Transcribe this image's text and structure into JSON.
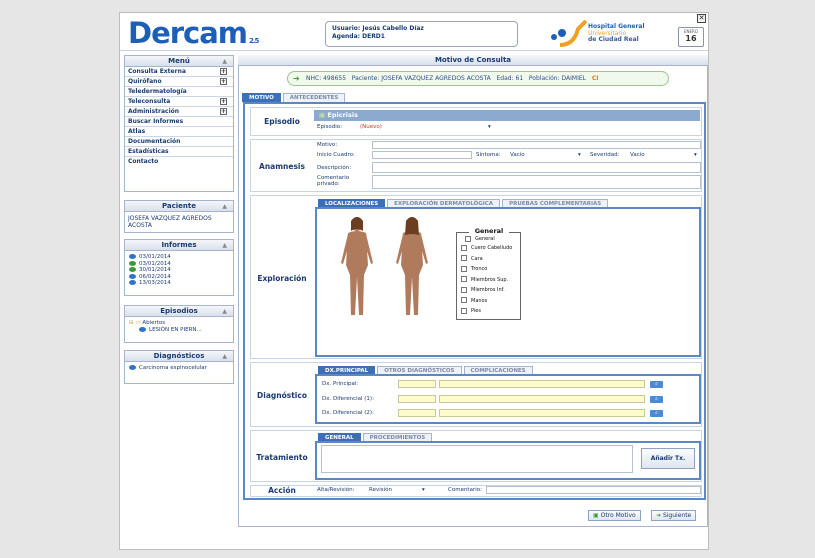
{
  "app": {
    "name": "Dercam",
    "version": "2.5"
  },
  "header": {
    "user_label": "Usuario: Jesús Cabello Díaz",
    "agenda_label": "Agenda: DERD1",
    "hospital_lines": [
      "Hospital General",
      "Universitario",
      "de Ciudad Real"
    ],
    "date_month": "ENERO",
    "date_day": "16",
    "close": "✕"
  },
  "menu": {
    "title": "Menú",
    "items": [
      {
        "label": "Consulta Externa",
        "expand": "+"
      },
      {
        "label": "Quirófano",
        "expand": "+"
      },
      {
        "label": "Teledermatología"
      },
      {
        "label": "Teleconsulta",
        "expand": "+"
      },
      {
        "label": "Administración",
        "expand": "+"
      },
      {
        "label": "Buscar Informes"
      },
      {
        "label": "Atlas"
      },
      {
        "label": "Documentación"
      },
      {
        "label": "Estadísticas"
      },
      {
        "label": "Contacto"
      }
    ]
  },
  "paciente": {
    "title": "Paciente",
    "name": "JOSEFA VAZQUEZ AGREDOS ACOSTA"
  },
  "informes": {
    "title": "Informes",
    "dates": [
      "03/01/2014",
      "03/01/2014",
      "30/01/2014",
      "06/02/2014",
      "13/03/2014"
    ]
  },
  "episodios": {
    "title": "Episodios",
    "folder": "Abiertos",
    "item": "LESIÓN EN PIERN..."
  },
  "diagnosticos": {
    "title": "Diagnósticos",
    "item": "Carcinoma espinocelular"
  },
  "main": {
    "title": "Motivo de Consulta",
    "patient_bar": {
      "nhc": "NHC: 498655",
      "paciente": "Paciente: JOSEFA VAZQUEZ AGREDOS ACOSTA",
      "edad": "Edad: 61",
      "poblacion": "Población: DAIMIEL",
      "ci": "CI"
    },
    "tabs": [
      "MOTIVO",
      "ANTECEDENTES"
    ],
    "episodio": {
      "label": "Episodio",
      "header": "Epicrisis",
      "field_label": "Episodio:",
      "value": "(Nuevo)"
    },
    "anamnesis": {
      "label": "Anamnesis",
      "motivo": "Motivo:",
      "inicio": "Inicio Cuadro:",
      "sintoma_label": "Síntoma:",
      "sintoma_value": "Vacío",
      "severidad_label": "Severidad:",
      "severidad_value": "Vacío",
      "descripcion": "Descripción:",
      "comentario": "Comentario privado:"
    },
    "exploracion": {
      "label": "Exploración",
      "tabs": [
        "LOCALIZACIONES",
        "EXPLORACIÓN DERMATOLÓGICA",
        "PRUEBAS COMPLEMENTARIAS"
      ],
      "legend_title": "General",
      "legend_items": [
        "General",
        "Cuero Cabelludo",
        "Cara",
        "Tronco",
        "Miembros Sup.",
        "Miembros Inf.",
        "Manos",
        "Pies"
      ]
    },
    "diagnostico": {
      "label": "Diagnóstico",
      "tabs": [
        "DX.PRINCIPAL",
        "OTROS DIAGNÓSTICOS",
        "COMPLICACIONES"
      ],
      "fields": [
        "Dx. Principal:",
        "Dx. Diferencial (1):",
        "Dx. Diferencial (2):"
      ]
    },
    "tratamiento": {
      "label": "Tratamiento",
      "tabs": [
        "GENERAL",
        "PROCEDIMIENTOS"
      ],
      "add_button": "Añadir Tx."
    },
    "accion": {
      "label": "Acción",
      "alta_label": "Alta/Revisión:",
      "alta_value": "Revisión",
      "comentario_label": "Comentario:"
    },
    "buttons": {
      "otro_motivo": "Otro Motivo",
      "siguiente": "Siguiente"
    }
  },
  "colors": {
    "accent": "#3c6fb6",
    "frame": "#5a87c5",
    "brand": "#1d5fb8"
  }
}
